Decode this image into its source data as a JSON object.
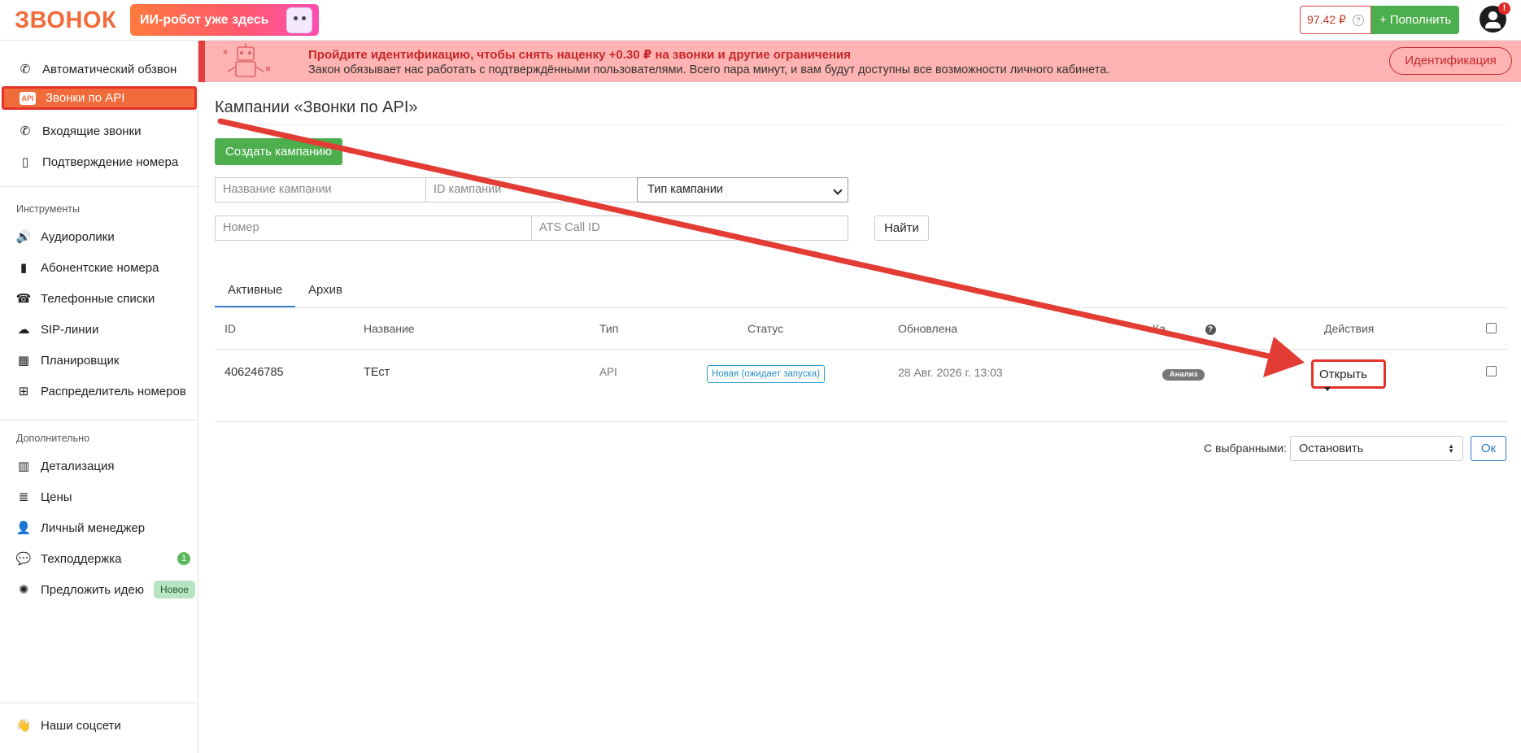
{
  "header": {
    "logo_text": "ЗВОНОК",
    "promo_text": "ИИ-робот уже здесь",
    "balance": "97.42 ₽",
    "balance_help": "?",
    "topup_label": "+ Пополнить",
    "alert_count": "!"
  },
  "sidebar": {
    "main_items": [
      {
        "label": "Автоматический обзвон",
        "icon": "phone-icon"
      },
      {
        "label": "Звонки по API",
        "icon": "api-icon",
        "icon_text": "API",
        "active": true
      },
      {
        "label": "Входящие звонки",
        "icon": "phone-incoming-icon"
      },
      {
        "label": "Подтверждение номера",
        "icon": "mobile-check-icon"
      }
    ],
    "tools_label": "Инструменты",
    "tools_items": [
      {
        "label": "Аудиоролики",
        "icon": "speaker-icon"
      },
      {
        "label": "Абонентские номера",
        "icon": "sim-card-icon"
      },
      {
        "label": "Телефонные списки",
        "icon": "phone-book-icon"
      },
      {
        "label": "SIP-линии",
        "icon": "cloud-icon"
      },
      {
        "label": "Планировщик",
        "icon": "calendar-icon"
      },
      {
        "label": "Распределитель номеров",
        "icon": "sitemap-icon"
      }
    ],
    "extra_label": "Дополнительно",
    "extra_items": [
      {
        "label": "Детализация",
        "icon": "chart-icon"
      },
      {
        "label": "Цены",
        "icon": "coins-icon"
      },
      {
        "label": "Личный менеджер",
        "icon": "user-tie-icon"
      },
      {
        "label": "Техподдержка",
        "icon": "chat-icon",
        "badge": "1"
      },
      {
        "label": "Предложить идею",
        "icon": "lightbulb-icon",
        "badge": "Новое"
      }
    ],
    "footer_item": {
      "label": "Наши соцсети",
      "icon": "wave-hand-icon"
    }
  },
  "banner": {
    "title": "Пройдите идентификацию, чтобы снять наценку +0.30 ₽ на звонки и другие ограничения",
    "text": "Закон обязывает нас работать с подтверждёнными пользователями. Всего пара минут, и вам будут доступны все возможности личного кабинета.",
    "button_label": "Идентификация"
  },
  "main": {
    "title": "Кампании «Звонки по API»",
    "create_button": "Создать кампанию",
    "filters": {
      "campaign_name_placeholder": "Название кампании",
      "campaign_id_placeholder": "ID кампании",
      "campaign_type_value": "Тип кампании",
      "number_placeholder": "Номер",
      "ats_call_id_placeholder": "ATS Call ID",
      "find_button": "Найти"
    },
    "tabs": [
      {
        "label": "Активные",
        "active": true
      },
      {
        "label": "Архив",
        "active": false
      }
    ],
    "table": {
      "headers": {
        "id": "ID",
        "name": "Название",
        "type": "Тип",
        "status": "Статус",
        "updated": "Обновлена",
        "quality": "Ка",
        "quality_help": "?",
        "actions": "Действия"
      },
      "rows": [
        {
          "id": "406246785",
          "name": "ТЕст",
          "type": "API",
          "status": "Новая (ожидает запуска)",
          "updated": "28 Авг. 2026 г. 13:03",
          "quality_badge": "Анализ",
          "action_label": "Открыть"
        }
      ]
    },
    "bulk": {
      "label": "С выбранными:",
      "selected_action": "Остановить",
      "ok_button": "Ок"
    }
  },
  "colors": {
    "brand_orange": "#f26b3a",
    "success_green": "#4cae4c",
    "banner_bg": "#ffb3b3",
    "highlight_red": "#e4322b",
    "link_blue": "#2a7ac9"
  }
}
